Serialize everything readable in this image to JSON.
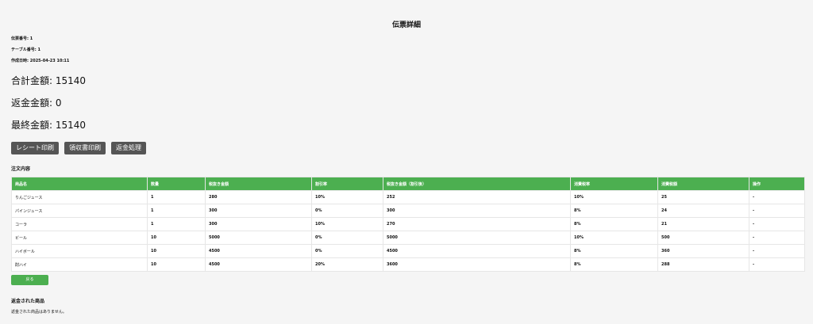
{
  "page": {
    "title": "伝票詳細"
  },
  "meta": {
    "slip_number": "伝票番号: 1",
    "table_number": "テーブル番号: 1",
    "created_at": "作成日時: 2025-04-23 10:11"
  },
  "amounts": {
    "total": "合計金額: 15140",
    "refund": "返金金額: 0",
    "final": "最終金額: 15140"
  },
  "actions": {
    "receipt": "レシート印刷",
    "invoice": "領収書印刷",
    "refund": "返金処理"
  },
  "order": {
    "heading": "注文内容",
    "columns": [
      "商品名",
      "数量",
      "税抜き金額",
      "割引率",
      "税抜き金額（割引後）",
      "消費税率",
      "消費税額",
      "操作"
    ],
    "rows": [
      [
        "りんごジュース",
        "1",
        "280",
        "10%",
        "252",
        "10%",
        "25",
        "-"
      ],
      [
        "パインジュース",
        "1",
        "300",
        "0%",
        "300",
        "8%",
        "24",
        "-"
      ],
      [
        "コーラ",
        "1",
        "300",
        "10%",
        "270",
        "8%",
        "21",
        "-"
      ],
      [
        "ビール",
        "10",
        "5000",
        "0%",
        "5000",
        "10%",
        "500",
        "-"
      ],
      [
        "ハイボール",
        "10",
        "4500",
        "0%",
        "4500",
        "8%",
        "360",
        "-"
      ],
      [
        "酎ハイ",
        "10",
        "4500",
        "20%",
        "3600",
        "8%",
        "288",
        "-"
      ]
    ]
  },
  "back": {
    "label": "戻る"
  },
  "refunds": {
    "heading": "返金された商品",
    "empty_message": "返金された商品はありません。"
  },
  "colors": {
    "accent": "#4caf50",
    "button_dark": "#555555"
  }
}
